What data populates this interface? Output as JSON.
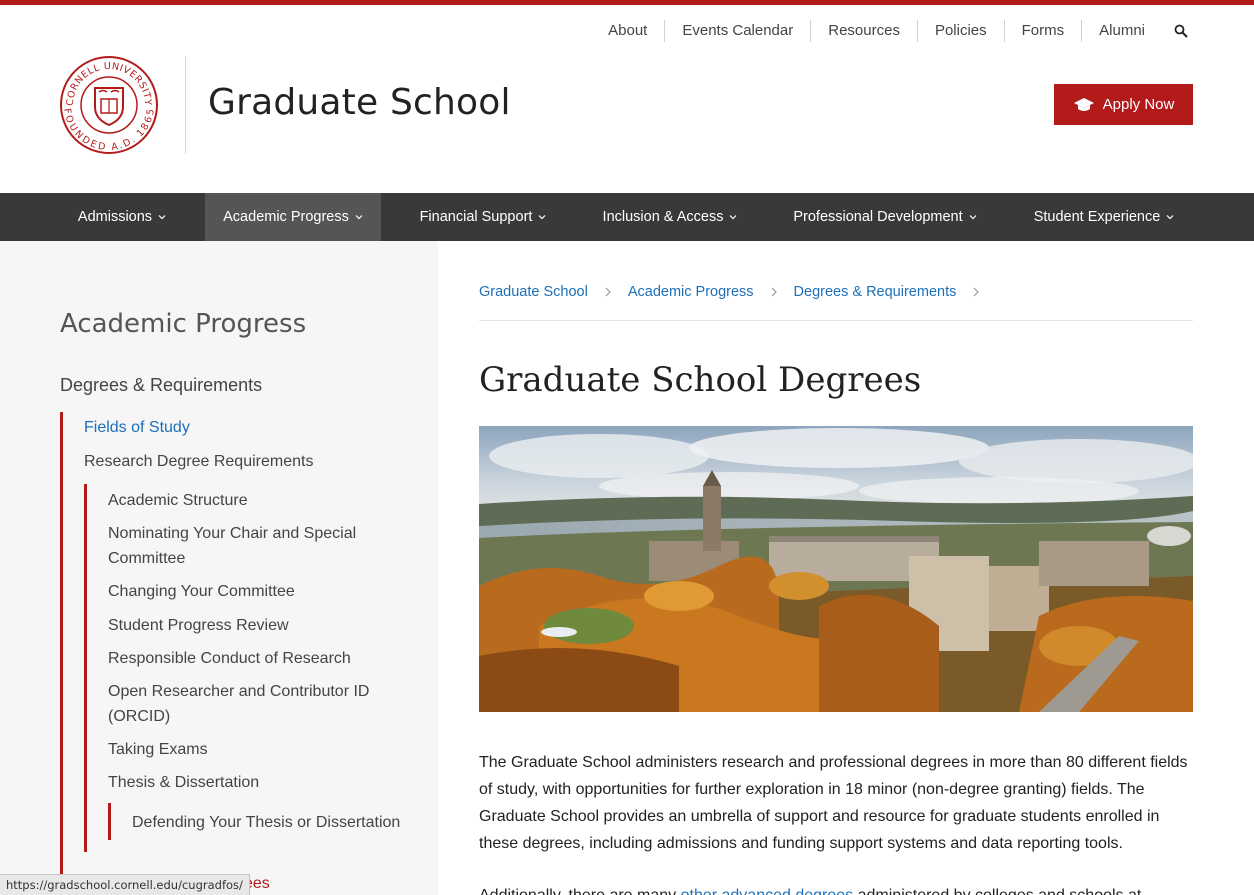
{
  "utility_nav": [
    "About",
    "Events Calendar",
    "Resources",
    "Policies",
    "Forms",
    "Alumni"
  ],
  "header": {
    "seal_text_top": "CORNELL UNIVERSITY",
    "seal_text_bottom": "FOUNDED A.D. 1865",
    "site_title": "Graduate School",
    "apply_label": "Apply Now"
  },
  "main_nav": [
    "Admissions",
    "Academic Progress",
    "Financial Support",
    "Inclusion & Access",
    "Professional Development",
    "Student Experience"
  ],
  "sidebar": {
    "title": "Academic Progress",
    "section": "Degrees & Requirements",
    "level1": [
      "Fields of Study",
      "Research Degree Requirements"
    ],
    "level2": [
      "Academic Structure",
      "Nominating Your Chair and Special Committee",
      "Changing Your Committee",
      "Student Progress Review",
      "Responsible Conduct of Research",
      "Open Researcher and Contributor ID (ORCID)",
      "Taking Exams",
      "Thesis & Dissertation"
    ],
    "level3": [
      "Defending Your Thesis or Dissertation"
    ],
    "partial_item": "ees"
  },
  "status_url": "https://gradschool.cornell.edu/cugradfos/",
  "breadcrumb": [
    "Graduate School",
    "Academic Progress",
    "Degrees & Requirements"
  ],
  "page_title": "Graduate School Degrees",
  "paragraph1": "The Graduate School administers research and professional degrees in more than 80 different fields of study, with opportunities for further exploration in 18 minor (non-degree granting) fields. The Graduate School provides an umbrella of support and resource for graduate students enrolled in these degrees, including admissions and funding support systems and data reporting tools.",
  "paragraph2": {
    "before": "Additionally, there are many ",
    "link": "other advanced degrees",
    "after": " administered by colleges and schools at"
  },
  "colors": {
    "brand": "#b31b1b",
    "nav_bg": "#393939",
    "nav_active": "#555555",
    "link": "#1c6fb8"
  }
}
